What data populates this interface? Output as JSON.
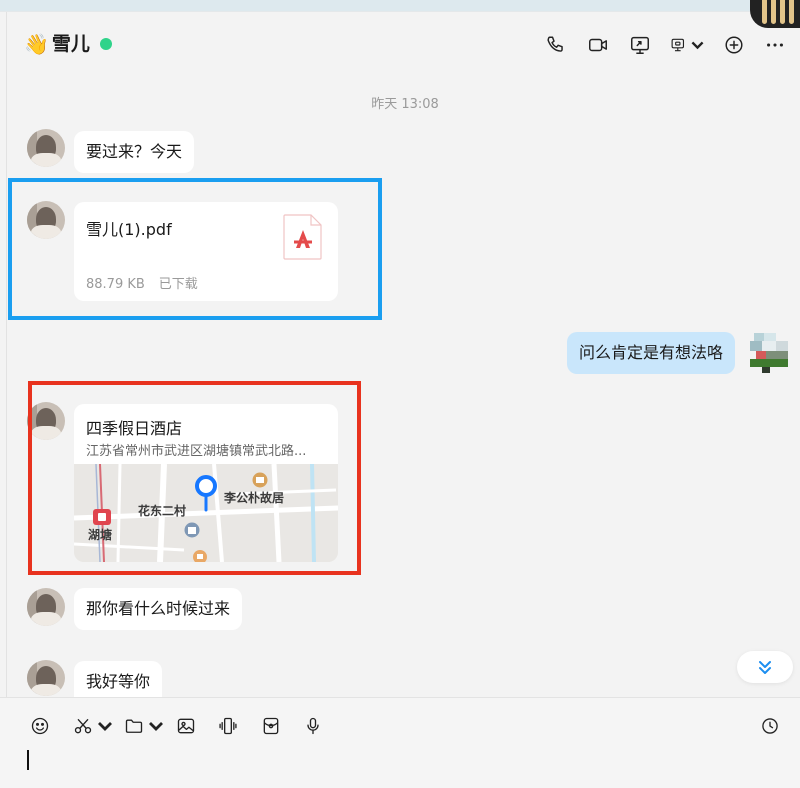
{
  "header": {
    "emoji": "👋",
    "contact_name": "雪儿",
    "status_color": "#2fd38a",
    "icons": [
      "phone-icon",
      "video-icon",
      "screen-share-icon",
      "remote-control-icon",
      "add-icon",
      "more-icon"
    ]
  },
  "chat": {
    "timestamp": "昨天 13:08",
    "messages": [
      {
        "type": "text",
        "text": "要过来？今天"
      },
      {
        "type": "file",
        "file_name": "雪儿(1).pdf",
        "size": "88.79 KB",
        "status": "已下载",
        "icon": "pdf-icon"
      },
      {
        "type": "text",
        "text": "问么肯定是有想法咯"
      },
      {
        "type": "location",
        "name": "四季假日酒店",
        "address": "江苏省常州市武进区湖塘镇常武北路...",
        "map_labels": {
          "village": "花东二村",
          "landmark": "李公朴故居",
          "town": "湖塘"
        }
      },
      {
        "type": "text",
        "text": "那你看什么时候过来"
      },
      {
        "type": "text",
        "text": "我好等你"
      }
    ]
  },
  "highlight_colors": {
    "file_box": "#1a9ef0",
    "location_box": "#e8321e"
  },
  "composer": {
    "icons": [
      "emoji-icon",
      "scissors-icon",
      "folder-icon",
      "image-icon",
      "shake-icon",
      "red-packet-icon",
      "mic-icon",
      "history-icon"
    ],
    "input_value": ""
  }
}
